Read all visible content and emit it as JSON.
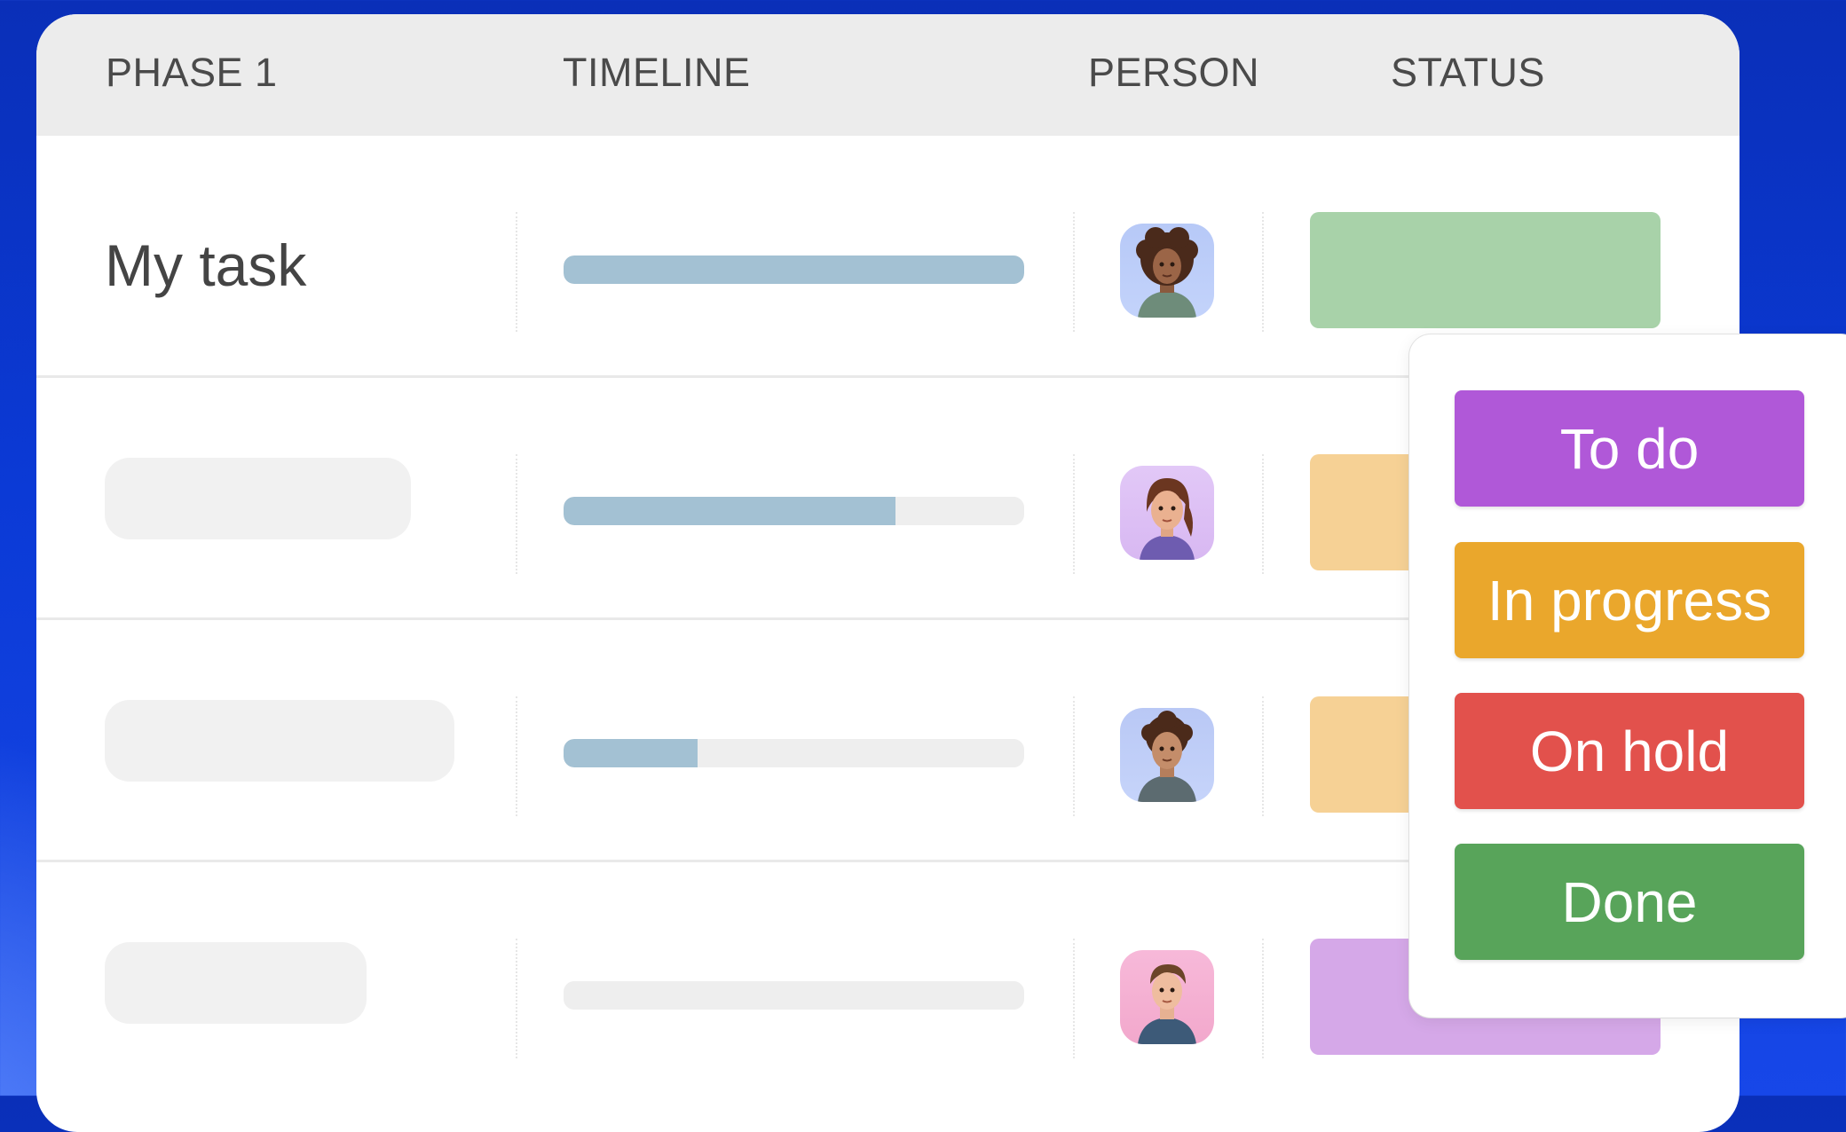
{
  "colors": {
    "todo": "#b058d8",
    "in_progress": "#eaa72c",
    "on_hold": "#e2514c",
    "done": "#58a45a",
    "status_done_light": "#a8d2a9",
    "status_progress_light": "#f6d195",
    "status_todo_light": "#d5a8e8",
    "timeline_fill": "#a3c1d3"
  },
  "header": {
    "phase": "PHASE 1",
    "timeline": "TIMELINE",
    "person": "PERSON",
    "status": "STATUS"
  },
  "rows": [
    {
      "task": "My task",
      "progress": 1.0,
      "avatar": "avatar-curly-hair",
      "status_color": "done-light"
    },
    {
      "task": "",
      "progress": 0.72,
      "avatar": "avatar-ponytail",
      "status_color": "progress-light"
    },
    {
      "task": "",
      "progress": 0.29,
      "avatar": "avatar-curly-hair-2",
      "status_color": "progress-light"
    },
    {
      "task": "",
      "progress": 0.0,
      "avatar": "avatar-short-hair",
      "status_color": "todo-light"
    }
  ],
  "status_menu": {
    "options": [
      {
        "label": "To do",
        "color": "#b058d8"
      },
      {
        "label": "In progress",
        "color": "#eaa72c"
      },
      {
        "label": "On hold",
        "color": "#e2514c"
      },
      {
        "label": "Done",
        "color": "#58a45a"
      }
    ]
  }
}
